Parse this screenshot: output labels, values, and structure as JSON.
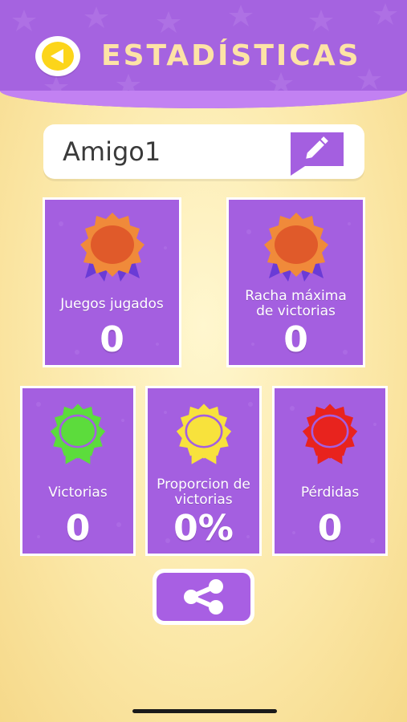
{
  "header": {
    "title": "ESTADÍSTICAS",
    "back_icon": "back-arrow-icon"
  },
  "player": {
    "name": "Amigo1",
    "edit_icon": "pencil-icon"
  },
  "stats": {
    "games_played": {
      "label": "Juegos jugados",
      "value": "0",
      "medal_color": "#f08a3a"
    },
    "max_streak": {
      "label_line1": "Racha máxima",
      "label_line2": "de victorias",
      "value": "0",
      "medal_color": "#f08a3a"
    },
    "wins": {
      "label": "Victorias",
      "value": "0",
      "medal_color": "#5cdc3c"
    },
    "win_ratio": {
      "label_line1": "Proporcion de",
      "label_line2": "victorias",
      "value": "0%",
      "medal_color": "#f8e23c"
    },
    "losses": {
      "label": "Pérdidas",
      "value": "0",
      "medal_color": "#e8231e"
    }
  },
  "share": {
    "icon": "share-icon"
  },
  "colors": {
    "purple": "#a45fe0",
    "title": "#fde3a6",
    "back_button": "#fcd51a"
  }
}
